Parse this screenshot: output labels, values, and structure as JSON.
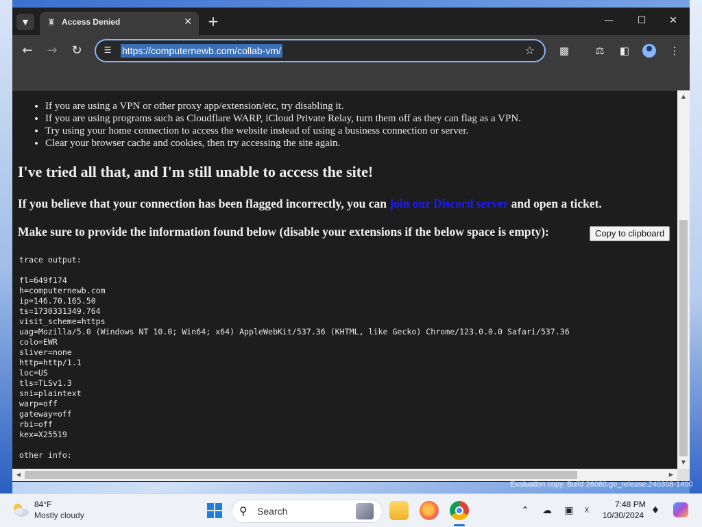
{
  "browser": {
    "tab_title": "Access Denied",
    "url": "https://computernewb.com/collab-vm/"
  },
  "page": {
    "bullets": [
      "If you are using a VPN or other proxy app/extension/etc, try disabling it.",
      "If you are using programs such as Cloudflare WARP, iCloud Private Relay, turn them off as they can flag as a VPN.",
      "Try using your home connection to access the website instead of using a business connection or server.",
      "Clear your browser cache and cookies, then try accessing the site again."
    ],
    "heading": "I've tried all that, and I'm still unable to access the site!",
    "ticket_prefix": "If you believe that your connection has been flagged incorrectly, you can ",
    "ticket_link": "join our Discord server",
    "ticket_suffix": " and open a ticket.",
    "provide_info": "Make sure to provide the information found below (disable your extensions if the below space is empty):",
    "copy_button": "Copy to clipboard",
    "trace_text": "trace output:\n\nfl=649f174\nh=computernewb.com\nip=146.70.165.50\nts=1730331349.764\nvisit_scheme=https\nuag=Mozilla/5.0 (Windows NT 10.0; Win64; x64) AppleWebKit/537.36 (KHTML, like Gecko) Chrome/123.0.0.0 Safari/537.36\ncolo=EWR\nsliver=none\nhttp=http/1.1\nloc=US\ntls=TLSv1.3\nsni=plaintext\nwarp=off\ngateway=off\nrbi=off\nkex=X25519\n\nother info:"
  },
  "watermark": "Evaluation copy. Build 26080.ge_release.240308-1400",
  "taskbar": {
    "weather_temp": "84°F",
    "weather_desc": "Mostly cloudy",
    "search_label": "Search",
    "time": "7:48 PM",
    "date": "10/30/2024"
  },
  "icons": {
    "tab_favicon": "ghost-icon",
    "back": "back-arrow-icon",
    "forward": "forward-arrow-icon",
    "reload": "reload-icon",
    "extensions": "puzzle-icon"
  }
}
